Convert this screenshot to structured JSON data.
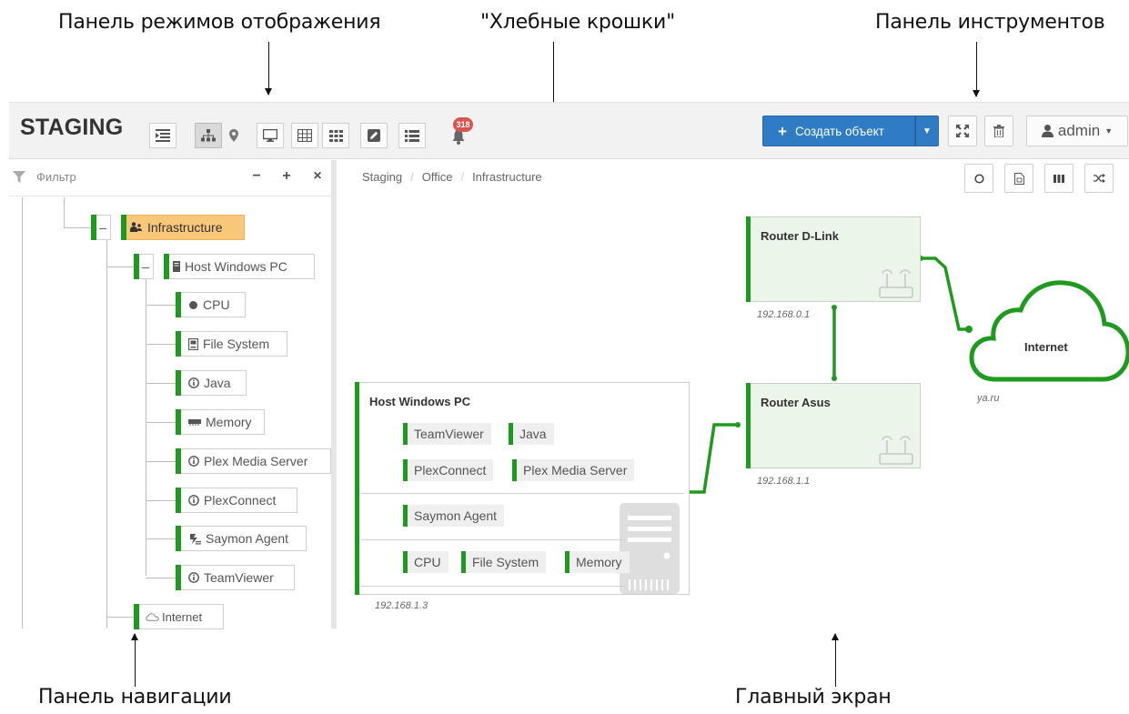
{
  "annotations": {
    "display_modes": "Панель режимов отображения",
    "breadcrumbs": "\"Хлебные крошки\"",
    "toolbar": "Панель инструментов",
    "navigation": "Панель навигации",
    "main_screen": "Главный экран"
  },
  "header": {
    "brand": "STAGING",
    "notifications_count": "318",
    "create_label": "Создать объект",
    "user": "admin"
  },
  "nav": {
    "filter_placeholder": "Фильтр",
    "collapse_label": "−",
    "expand_label": "+",
    "close_label": "×",
    "tree": {
      "infrastructure": "Infrastructure",
      "host": "Host Windows PC",
      "children": [
        "CPU",
        "File System",
        "Java",
        "Memory",
        "Plex Media Server",
        "PlexConnect",
        "Saymon Agent",
        "TeamViewer"
      ],
      "internet": "Internet"
    }
  },
  "breadcrumbs": [
    "Staging",
    "Office",
    "Infrastructure"
  ],
  "diagram": {
    "host": {
      "title": "Host Windows PC",
      "ip": "192.168.1.3",
      "row1": [
        "TeamViewer",
        "Java"
      ],
      "row2": [
        "PlexConnect",
        "Plex Media Server"
      ],
      "row3": [
        "Saymon Agent"
      ],
      "row4": [
        "CPU",
        "File System",
        "Memory"
      ]
    },
    "router_dlink": {
      "title": "Router D-Link",
      "ip": "192.168.0.1"
    },
    "router_asus": {
      "title": "Router Asus",
      "ip": "192.168.1.1"
    },
    "internet": {
      "title": "Internet",
      "ip": "ya.ru"
    }
  },
  "colors": {
    "status_green": "#1e9b1e",
    "accent_blue": "#2f7bc4",
    "selected_orange": "#f8c77a",
    "badge_red": "#d9534f"
  }
}
